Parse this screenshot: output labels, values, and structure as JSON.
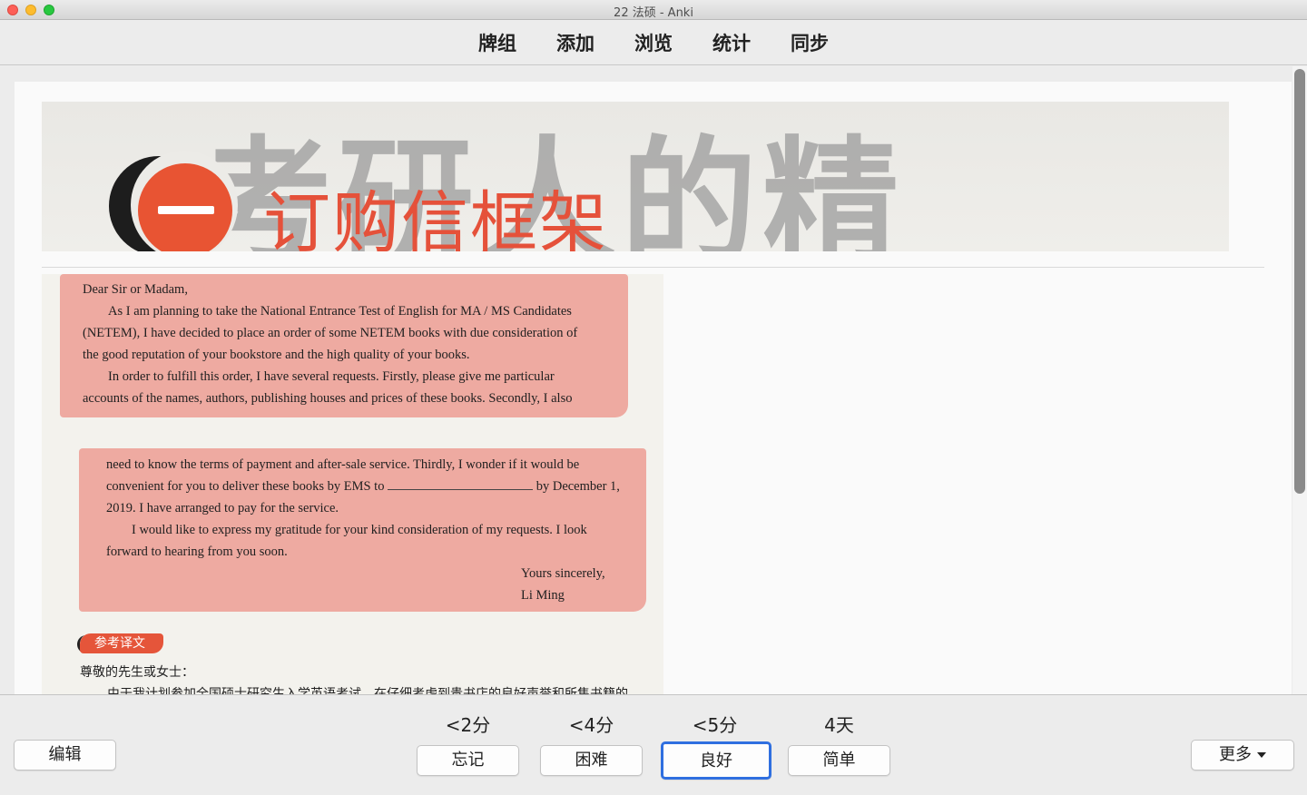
{
  "window": {
    "title": "22 法硕 - Anki"
  },
  "toolbar": {
    "items": [
      "牌组",
      "添加",
      "浏览",
      "统计",
      "同步"
    ]
  },
  "card": {
    "banner_title": "订购信框架",
    "banner_bg_text": "考研人的精",
    "letter": {
      "p1": [
        "Dear Sir or Madam,",
        "As I am planning to take the National Entrance Test of English for MA / MS Candidates",
        "(NETEM), I have decided to place an order of some NETEM books with due consideration of",
        "the good reputation of your bookstore and the high quality of your books.",
        "In order to fulfill this order, I have several requests. Firstly, please give me particular",
        "accounts of the names, authors, publishing houses and prices of these books. Secondly, I also"
      ],
      "p2": [
        "need to know the terms of payment and after-sale service. Thirdly, I wonder if it would be",
        "convenient for you to deliver these books by EMS to",
        "by December 1,",
        "2019. I have arranged to pay for the service.",
        "I would like to express my gratitude for your kind consideration of my requests. I look",
        "forward to hearing from you soon.",
        "Yours sincerely,",
        "Li Ming"
      ]
    },
    "ref_tag": "参考译文",
    "zh_greeting": "尊敬的先生或女士：",
    "zh_line": "由于我计划参加全国硕士研究生入学英语考试，在仔细考虑到贵书店的良好声誉和所售书籍的"
  },
  "answer_bar": {
    "edit_label": "编辑",
    "more_label": "更多",
    "intervals": [
      "<2分",
      "<4分",
      "<5分",
      "4天"
    ],
    "buttons": [
      "忘记",
      "困难",
      "良好",
      "简单"
    ]
  },
  "colors": {
    "highlight": "#eeaaa1",
    "accent": "#e5553a",
    "focus": "#2f6fe0"
  }
}
